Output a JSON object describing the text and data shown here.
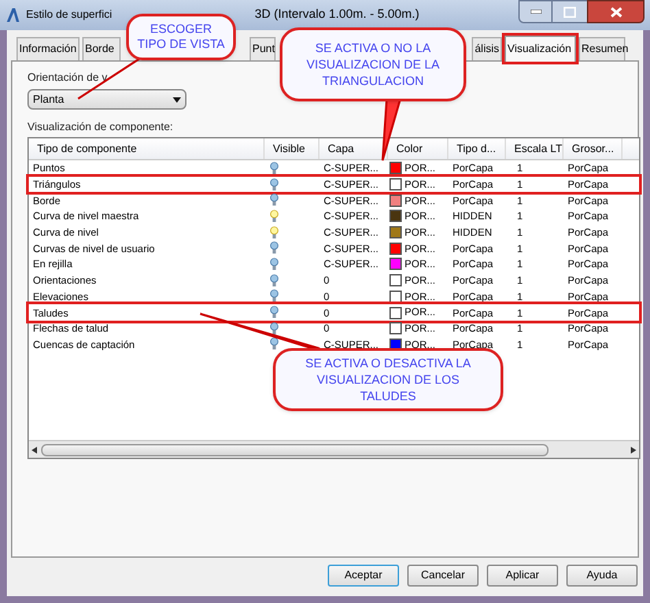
{
  "window": {
    "title_parts": [
      "Estilo de superfici",
      "3D (Intervalo 1.00m. - 5.00m.)"
    ]
  },
  "tabs": [
    {
      "label": "Información",
      "selected": false,
      "highlighted": false
    },
    {
      "label": "Borde",
      "selected": false,
      "highlighted": false
    },
    {
      "label": "Punt",
      "selected": false,
      "highlighted": false
    },
    {
      "label": "álisis",
      "selected": false,
      "highlighted": false
    },
    {
      "label": "Visualización",
      "selected": true,
      "highlighted": true
    },
    {
      "label": "Resumen",
      "selected": false,
      "highlighted": false
    }
  ],
  "view_orientation": {
    "label": "Orientación de v",
    "value": "Planta"
  },
  "component_display": {
    "label": "Visualización de componente:",
    "columns": [
      "Tipo de componente",
      "Visible",
      "Capa",
      "Color",
      "Tipo d...",
      "Escala LT",
      "Grosor..."
    ],
    "rows": [
      {
        "component": "Puntos",
        "visible": false,
        "layer": "C-SUPER...",
        "color": "#ff0000",
        "color_name": "POR...",
        "linetype": "PorCapa",
        "lt_scale": "1",
        "lineweight": "PorCapa",
        "highlighted": false
      },
      {
        "component": "Triángulos",
        "visible": false,
        "layer": "C-SUPER...",
        "color": "#ffffff",
        "color_name": "POR...",
        "linetype": "PorCapa",
        "lt_scale": "1",
        "lineweight": "PorCapa",
        "highlighted": true
      },
      {
        "component": "Borde",
        "visible": false,
        "layer": "C-SUPER...",
        "color": "#f08080",
        "color_name": "POR...",
        "linetype": "PorCapa",
        "lt_scale": "1",
        "lineweight": "PorCapa",
        "highlighted": false
      },
      {
        "component": "Curva de nivel maestra",
        "visible": true,
        "layer": "C-SUPER...",
        "color": "#4a3510",
        "color_name": "POR...",
        "linetype": "HIDDEN",
        "lt_scale": "1",
        "lineweight": "PorCapa",
        "highlighted": false
      },
      {
        "component": "Curva de nivel",
        "visible": true,
        "layer": "C-SUPER...",
        "color": "#a07818",
        "color_name": "POR...",
        "linetype": "HIDDEN",
        "lt_scale": "1",
        "lineweight": "PorCapa",
        "highlighted": false
      },
      {
        "component": "Curvas de nivel de usuario",
        "visible": false,
        "layer": "C-SUPER...",
        "color": "#ff0000",
        "color_name": "POR...",
        "linetype": "PorCapa",
        "lt_scale": "1",
        "lineweight": "PorCapa",
        "highlighted": false
      },
      {
        "component": "En rejilla",
        "visible": false,
        "layer": "C-SUPER...",
        "color": "#ff00ff",
        "color_name": "POR...",
        "linetype": "PorCapa",
        "lt_scale": "1",
        "lineweight": "PorCapa",
        "highlighted": false
      },
      {
        "component": "Orientaciones",
        "visible": false,
        "layer": "0",
        "color": "#ffffff",
        "color_name": "POR...",
        "linetype": "PorCapa",
        "lt_scale": "1",
        "lineweight": "PorCapa",
        "highlighted": false
      },
      {
        "component": "Elevaciones",
        "visible": false,
        "layer": "0",
        "color": "#ffffff",
        "color_name": "POR...",
        "linetype": "PorCapa",
        "lt_scale": "1",
        "lineweight": "PorCapa",
        "highlighted": false
      },
      {
        "component": "Taludes",
        "visible": false,
        "layer": "0",
        "color": "#ffffff",
        "color_name": "POR...",
        "linetype": "PorCapa",
        "lt_scale": "1",
        "lineweight": "PorCapa",
        "highlighted": true
      },
      {
        "component": "Flechas de talud",
        "visible": false,
        "layer": "0",
        "color": "#ffffff",
        "color_name": "POR...",
        "linetype": "PorCapa",
        "lt_scale": "1",
        "lineweight": "PorCapa",
        "highlighted": false
      },
      {
        "component": "Cuencas de captación",
        "visible": false,
        "layer": "C-SUPER...",
        "color": "#0000ff",
        "color_name": "POR...",
        "linetype": "PorCapa",
        "lt_scale": "1",
        "lineweight": "PorCapa",
        "highlighted": false
      }
    ]
  },
  "buttons": [
    {
      "label": "Aceptar",
      "default": true
    },
    {
      "label": "Cancelar",
      "default": false
    },
    {
      "label": "Aplicar",
      "default": false
    },
    {
      "label": "Ayuda",
      "default": false
    }
  ],
  "callouts": [
    {
      "text": "ESCOGER TIPO DE VISTA"
    },
    {
      "text": "SE ACTIVA O NO LA VISUALIZACION DE LA TRIANGULACION"
    },
    {
      "text": "SE ACTIVA O DESACTIVA LA VISUALIZACION DE LOS TALUDES"
    }
  ]
}
